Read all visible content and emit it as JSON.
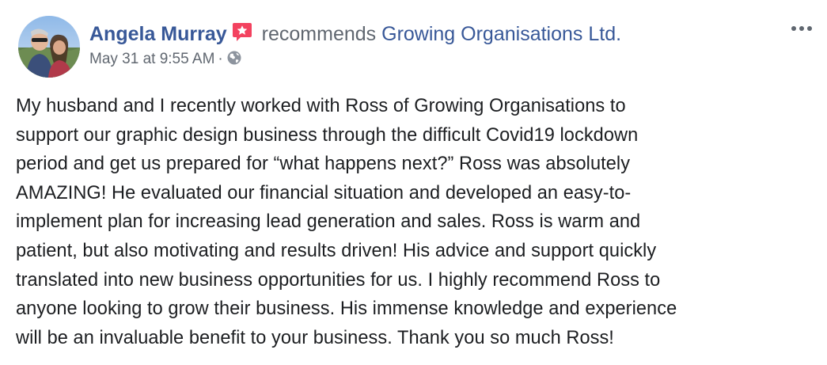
{
  "post": {
    "author": "Angela Murray",
    "verb": "recommends",
    "page_name": "Growing Organisations Ltd.",
    "timestamp": "May 31 at 9:55 AM",
    "separator": "·",
    "privacy_icon": "globe-icon",
    "recommend_icon": "recommend-star-icon",
    "more_icon": "more-options-icon",
    "body_lines": [
      "My husband and I recently worked with Ross of Growing Organisations to",
      "support our graphic design business through the difficult Covid19 lockdown",
      "period and get us prepared for “what happens next?” Ross was absolutely",
      "AMAZING! He evaluated our financial situation and developed an easy-to-",
      "implement plan for increasing lead generation and sales. Ross is warm and",
      "patient, but also motivating and results driven! His advice and support quickly",
      "translated into new business opportunities for us. I highly recommend Ross to",
      "anyone looking to grow their business. His immense knowledge and experience",
      "will be an invaluable benefit to your business. Thank you so much Ross!"
    ]
  },
  "colors": {
    "link": "#385898",
    "secondary": "#606770",
    "text": "#1c1e21",
    "recommend_badge": "#f3425f"
  }
}
